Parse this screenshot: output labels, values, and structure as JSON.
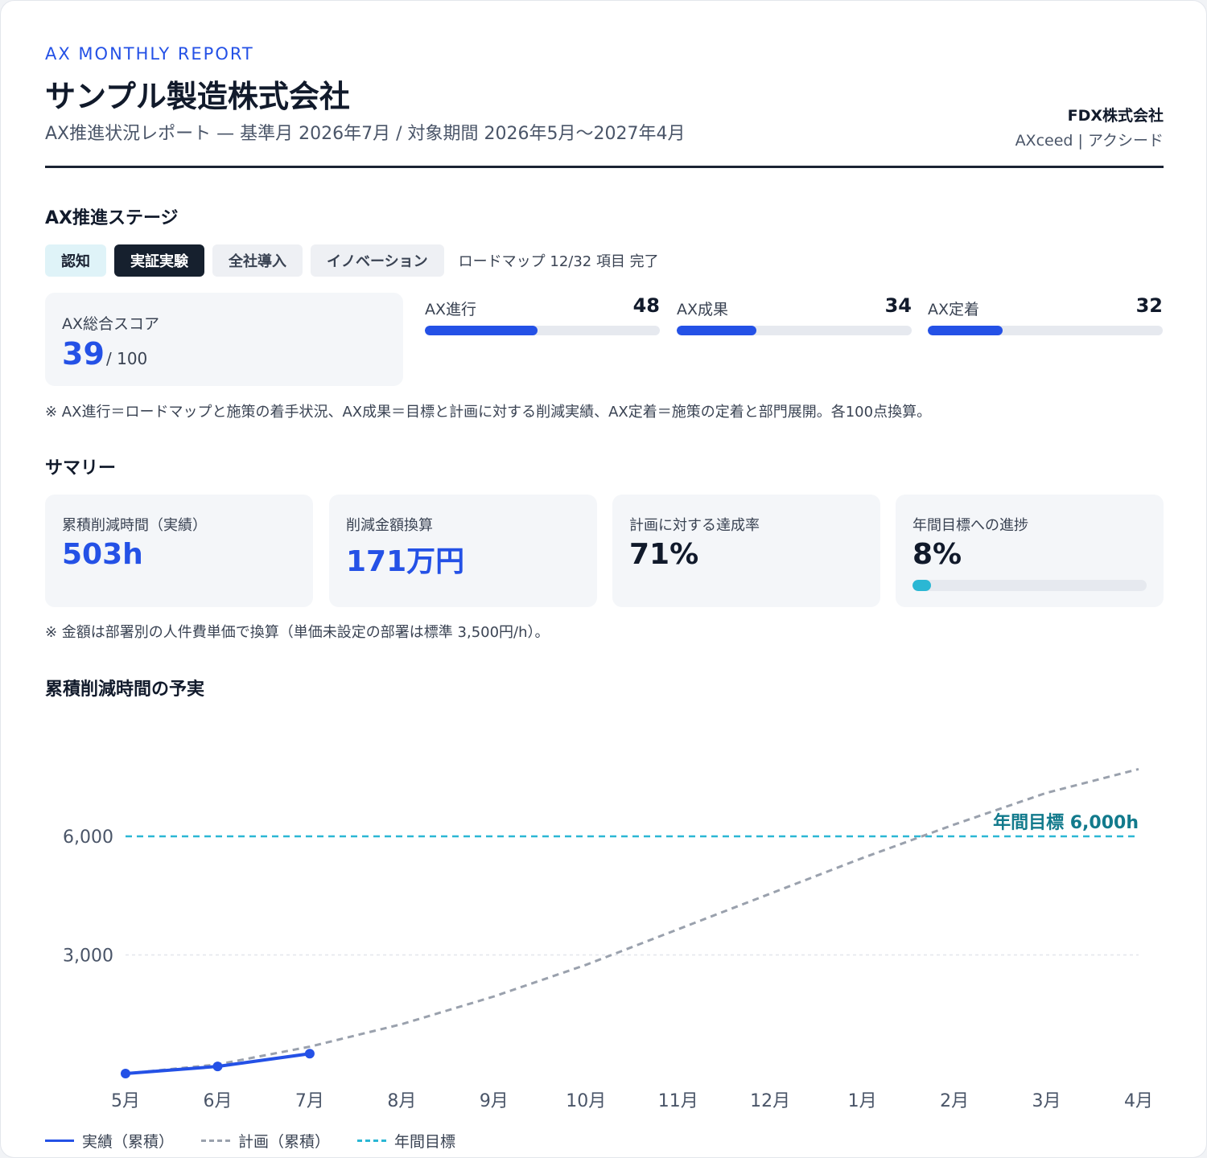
{
  "header": {
    "eyebrow": "AX MONTHLY REPORT",
    "title": "サンプル製造株式会社",
    "subtitle": "AX推進状況レポート — 基準月 2026年7月 / 対象期間 2026年5月〜2027年4月",
    "brand_name": "FDX株式会社",
    "brand_sub": "AXceed | アクシード"
  },
  "stage": {
    "title": "AX推進ステージ",
    "chips": [
      {
        "label": "認知",
        "state": "done"
      },
      {
        "label": "実証実験",
        "state": "active"
      },
      {
        "label": "全社導入",
        "state": "upcoming"
      },
      {
        "label": "イノベーション",
        "state": "upcoming"
      }
    ],
    "roadmap": "ロードマップ 12/32 項目 完了",
    "total_label": "AX総合スコア",
    "total_value": "39",
    "total_max": "/ 100",
    "metrics": [
      {
        "label": "AX進行",
        "value": "48",
        "fraction": 0.48
      },
      {
        "label": "AX成果",
        "value": "34",
        "fraction": 0.34
      },
      {
        "label": "AX定着",
        "value": "32",
        "fraction": 0.32
      }
    ],
    "note": "※ AX進行＝ロードマップと施策の着手状況、AX成果＝目標と計画に対する削減実績、AX定着＝施策の定着と部門展開。各100点換算。"
  },
  "summary": {
    "title": "サマリー",
    "cards": [
      {
        "label": "累積削減時間（実績）",
        "value": "503h",
        "color": "#2451e6"
      },
      {
        "label": "削減金額換算",
        "value": "171万円",
        "color": "#2451e6"
      },
      {
        "label": "計画に対する達成率",
        "value": "71%",
        "color": "#111a2b"
      },
      {
        "label": "年間目標への進捗",
        "value": "8%",
        "color": "#111a2b",
        "progress": 0.08
      }
    ],
    "note": "※ 金額は部署別の人件費単価で換算（単価未設定の部署は標準 3,500円/h）。"
  },
  "chart_data": {
    "type": "line",
    "title": "累積削減時間の予実",
    "x": [
      "5月",
      "6月",
      "7月",
      "8月",
      "9月",
      "10月",
      "11月",
      "12月",
      "1月",
      "2月",
      "3月",
      "4月"
    ],
    "yticks": [
      3000,
      6000
    ],
    "ytick_labels": [
      "3,000",
      "6,000"
    ],
    "ylim": [
      0,
      7800
    ],
    "grid": true,
    "legend": "bottom-left",
    "series": [
      {
        "name": "実績（累積）",
        "style": "solid",
        "color": "#2451e6",
        "values": [
          0,
          180,
          503
        ]
      },
      {
        "name": "計画（累積）",
        "style": "dashed",
        "color": "#9aa1ad",
        "values": [
          0,
          230,
          680,
          1250,
          1950,
          2750,
          3650,
          4550,
          5450,
          6300,
          7100,
          7700
        ]
      }
    ],
    "target": {
      "name": "年間目標",
      "value": 6000,
      "label": "年間目標 6,000h",
      "color": "#2bb7d4",
      "label_color": "#127a8c"
    }
  }
}
